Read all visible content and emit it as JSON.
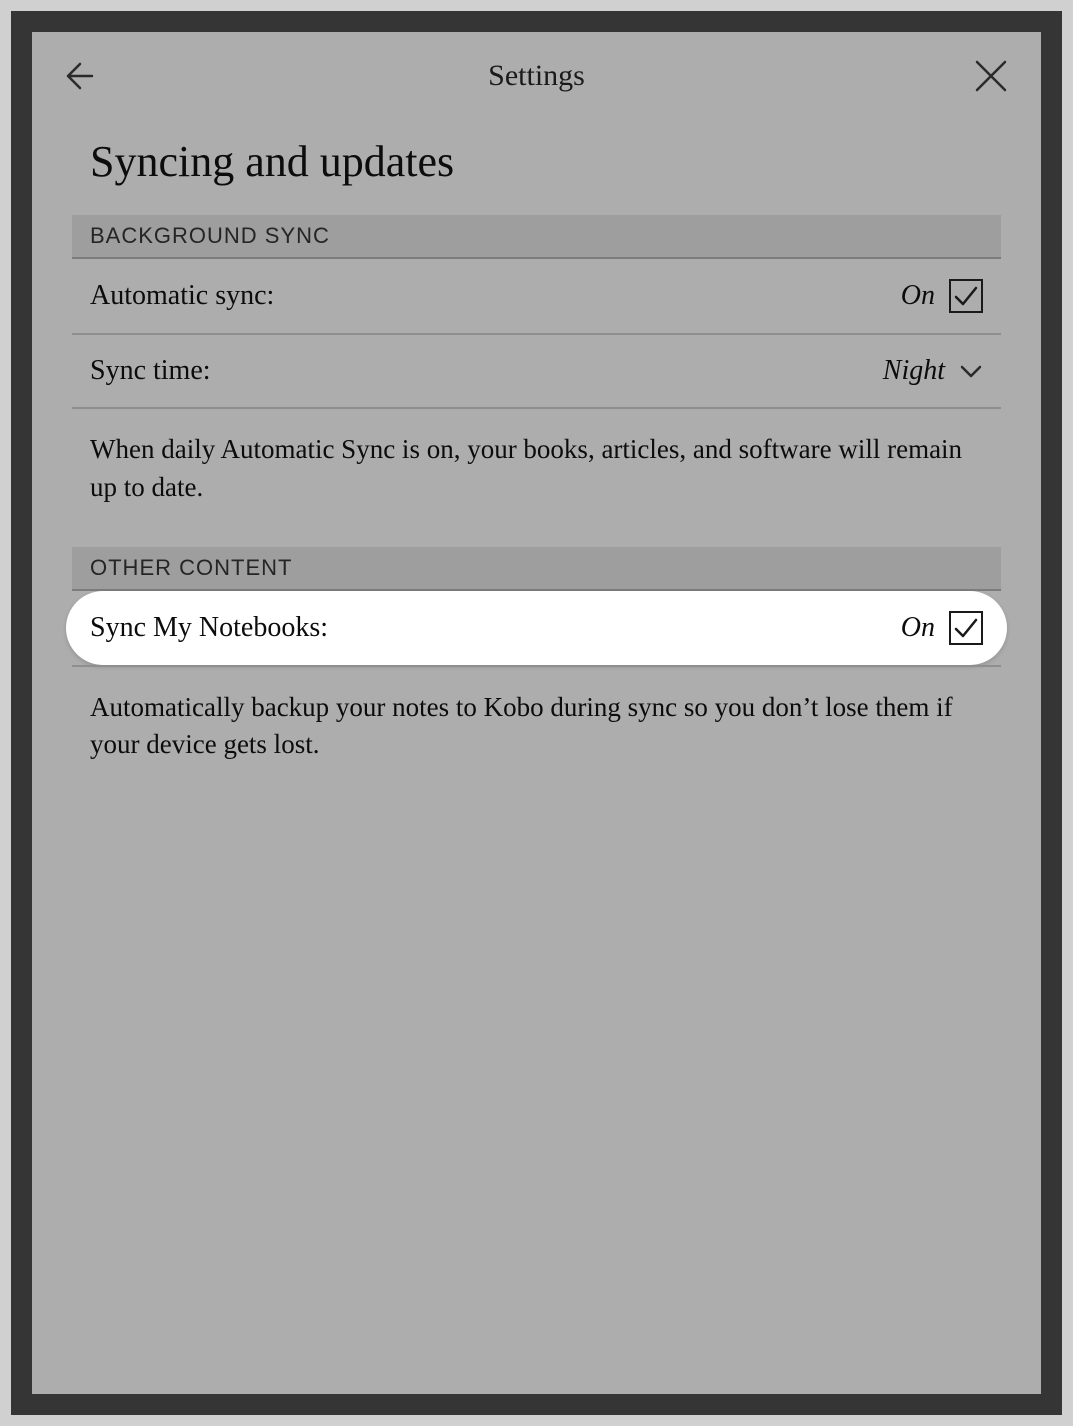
{
  "header": {
    "title": "Settings"
  },
  "page": {
    "title": "Syncing and updates"
  },
  "sections": {
    "background_sync": {
      "header": "BACKGROUND SYNC",
      "auto_sync": {
        "label": "Automatic sync:",
        "value": "On",
        "checked": true
      },
      "sync_time": {
        "label": "Sync time:",
        "value": "Night"
      },
      "description": "When daily Automatic Sync is on, your books, articles, and software will remain up to date."
    },
    "other_content": {
      "header": "OTHER CONTENT",
      "sync_notebooks": {
        "label": "Sync My Notebooks:",
        "value": "On",
        "checked": true
      },
      "description": "Automatically backup your notes to Kobo during sync so you don’t lose them if your device gets lost."
    }
  }
}
